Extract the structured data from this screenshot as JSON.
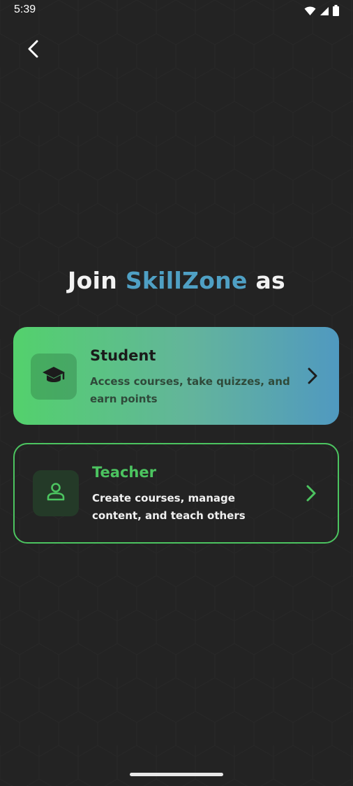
{
  "status_bar": {
    "time": "5:39",
    "icons": [
      "wifi-icon",
      "cellular-signal-icon",
      "battery-icon"
    ]
  },
  "header": {
    "back_icon": "chevron-left-icon"
  },
  "heading": {
    "prefix": "Join",
    "brand": "SkillZone",
    "suffix": "as"
  },
  "roles": [
    {
      "id": "student",
      "title": "Student",
      "description": "Access courses, take quizzes, and earn points",
      "icon": "graduation-cap-icon",
      "chevron": "chevron-right-icon"
    },
    {
      "id": "teacher",
      "title": "Teacher",
      "description": "Create courses, manage content, and teach others",
      "icon": "person-icon",
      "chevron": "chevron-right-icon"
    }
  ],
  "colors": {
    "background": "#232323",
    "brand_blue": "#4fa0c4",
    "accent_green": "#4cc460",
    "student_gradient_start": "#53d16c",
    "student_gradient_end": "#5099c0"
  }
}
